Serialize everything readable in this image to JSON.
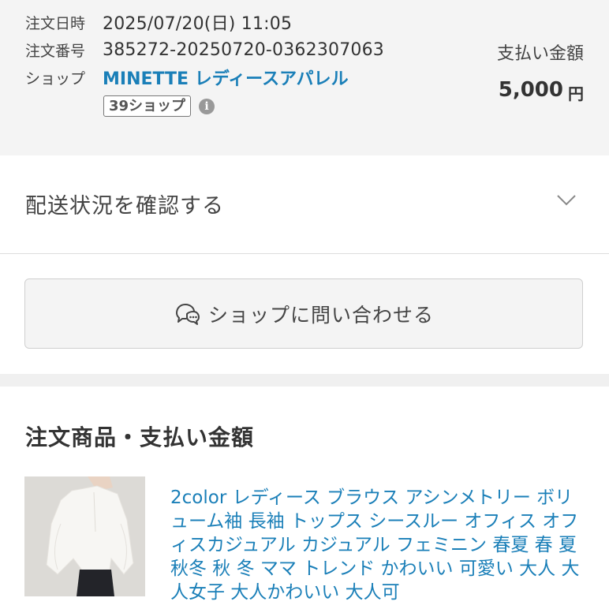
{
  "order": {
    "date_label": "注文日時",
    "date_value": "2025/07/20(日) 11:05",
    "number_label": "注文番号",
    "number_value": "385272-20250720-0362307063",
    "shop_label": "ショップ",
    "shop_name": "MINETTE レディースアパレル",
    "badge": "39ショップ",
    "info_icon": "info-icon"
  },
  "payment": {
    "label": "支払い金額",
    "amount": "5,000",
    "currency": "円"
  },
  "delivery": {
    "label": "配送状況を確認する",
    "icon": "chevron-down-icon"
  },
  "contact": {
    "label": "ショップに問い合わせる",
    "icon": "chat-bubbles-icon"
  },
  "section": {
    "title": "注文商品・支払い金額"
  },
  "product": {
    "title": "2color レディース ブラウス アシンメトリー ボリューム袖 長袖 トップス シースルー オフィス オフィスカジュアル カジュアル フェミニン 春夏 春 夏 秋冬 秋 冬 ママ トレンド かわいい 可愛い 大人 大人女子 大人かわいい 大人可"
  },
  "colors": {
    "link": "#1a7fb8",
    "summary_bg": "#f4f4f4"
  }
}
